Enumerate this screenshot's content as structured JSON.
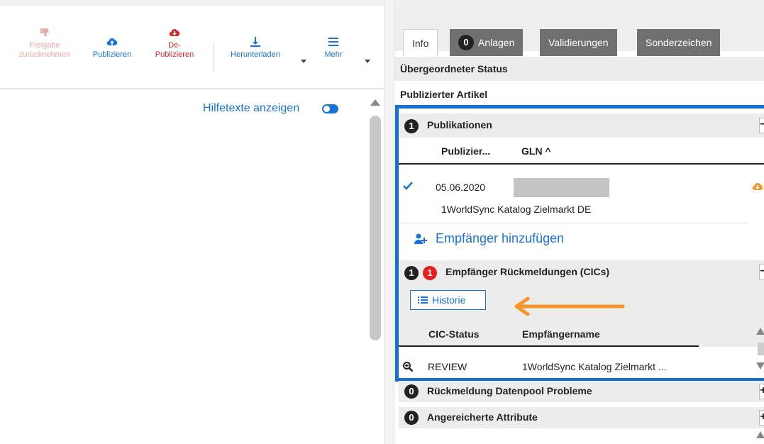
{
  "toolbar": {
    "freigabe_label_1": "Freigabe",
    "freigabe_label_2": "zurücknehmen",
    "publizieren_label": "Publizieren",
    "depublizieren_label_1": "De-",
    "depublizieren_label_2": "Publizieren",
    "herunterladen_label": "Herunterladen",
    "mehr_label": "Mehr"
  },
  "left": {
    "help_text": "Hilfetexte anzeigen"
  },
  "tabs": [
    {
      "label": "Info",
      "count": ""
    },
    {
      "label": "Anlagen",
      "count": "0"
    },
    {
      "label": "Validierungen",
      "count": ""
    },
    {
      "label": "Sonderzeichen",
      "count": ""
    }
  ],
  "status": {
    "parent_status_label": "Übergeordneter Status",
    "published_article_label": "Publizierter Artikel"
  },
  "publikationen": {
    "count": "1",
    "title": "Publikationen",
    "toggle": "−",
    "col_published": "Publizier...",
    "col_gln": "GLN ^",
    "row_date": "05.06.2020",
    "row_recipient": "1WorldSync Katalog Zielmarkt DE",
    "add_recipient": "Empfänger hinzufügen"
  },
  "cics": {
    "count": "1",
    "alert_count": "1",
    "title": "Empfänger Rückmeldungen (CICs)",
    "toggle": "−",
    "history_button": "Historie",
    "col_status": "CIC-Status",
    "col_name": "Empfängername",
    "row_status": "REVIEW",
    "row_name": "1WorldSync Katalog Zielmarkt ..."
  },
  "datapool": {
    "count": "0",
    "title": "Rückmeldung Datenpool Probleme",
    "toggle": "+"
  },
  "enriched": {
    "count": "0",
    "title": "Angereicherte Attribute",
    "toggle": "+"
  },
  "colors": {
    "accent_blue": "#1a73d9",
    "frame_blue": "#1570d6",
    "danger_red": "#d9262c",
    "annotation_orange": "#f5962a"
  }
}
